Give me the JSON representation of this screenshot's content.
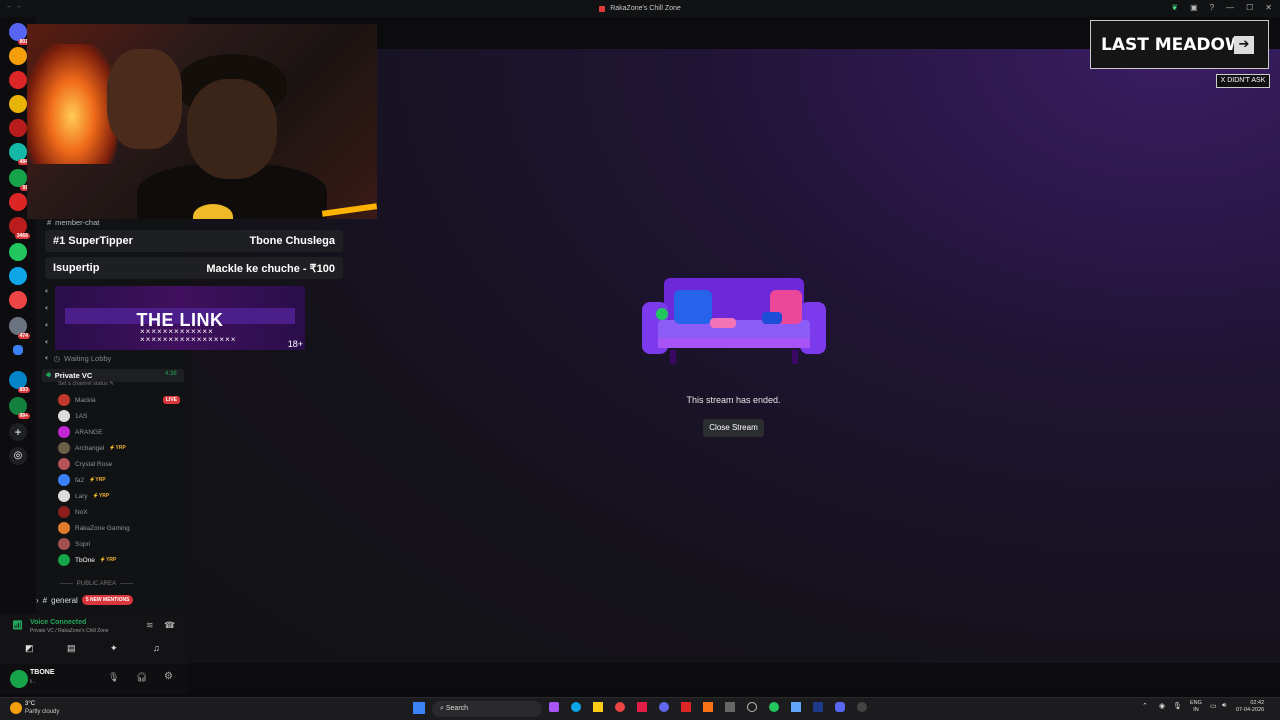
{
  "window": {
    "title": "RakaZone's Chill Zone"
  },
  "stream": {
    "ended_text": "This stream has ended.",
    "close_label": "Close Stream"
  },
  "overlay": {
    "brand": "LAST MEADOW",
    "brand_arrow": "➔",
    "didnt_ask": "X DIDN'T ASK",
    "member_chat": "member-chat",
    "tip1_left": "#1 SuperTipper",
    "tip1_right": "Tbone Chuslega",
    "tip2_left": "Isupertip",
    "tip2_right": "Mackle ke chuche - ₹100",
    "banner_title": "THE LINK",
    "banner_xs": "×××××××××××××\n×××××××××××××××××",
    "banner_age": "18+"
  },
  "sidebar": {
    "waiting_lobby": "Waiting Lobby",
    "private_vc": "Private VC",
    "private_vc_time": "4:38",
    "set_status": "Set a channel status ✎",
    "members": [
      {
        "name": "Mackla",
        "badge": "",
        "live": "LIVE",
        "color": "#c0392b"
      },
      {
        "name": "1AS",
        "badge": "",
        "live": "",
        "color": "#ddd"
      },
      {
        "name": "ARANGE",
        "badge": "",
        "live": "",
        "color": "#c026d3"
      },
      {
        "name": "Archangel",
        "badge": "⚡YRP",
        "live": "",
        "color": "#6b5e4a"
      },
      {
        "name": "Crystal Rose",
        "badge": "",
        "live": "",
        "color": "#b45353"
      },
      {
        "name": "fa2",
        "badge": "⚡YRP",
        "live": "",
        "color": "#3b82f6"
      },
      {
        "name": "Lary",
        "badge": "⚡YRP",
        "live": "",
        "color": "#ddd"
      },
      {
        "name": "NoX",
        "badge": "",
        "live": "",
        "color": "#8b1e1e"
      },
      {
        "name": "RakaZone Gaming",
        "badge": "",
        "live": "",
        "color": "#e07a2e"
      },
      {
        "name": "Sopri",
        "badge": "",
        "live": "",
        "color": "#a05252"
      },
      {
        "name": "TbOne",
        "badge": "⚡YRP",
        "live": "",
        "color": "#16a34a"
      }
    ],
    "public_area": "PUBLIC AREA",
    "general": "general",
    "mentions": "5 NEW MENTIONS"
  },
  "voice": {
    "status": "Voice Connected",
    "location": "Private VC / RakaZone's Chill Zone"
  },
  "user": {
    "name": "TBONE",
    "sub": "li..."
  },
  "taskbar": {
    "weather_temp": "3°C",
    "weather_desc": "Partly cloudy",
    "search": "Search",
    "lang1": "ENG",
    "lang2": "IN",
    "time": "02:42",
    "date": "07-04-2026"
  },
  "server_badges": [
    "801",
    "",
    "",
    "",
    "",
    "484",
    "",
    "91",
    "3466",
    "",
    "",
    "",
    "474",
    "",
    "893",
    "99+"
  ]
}
